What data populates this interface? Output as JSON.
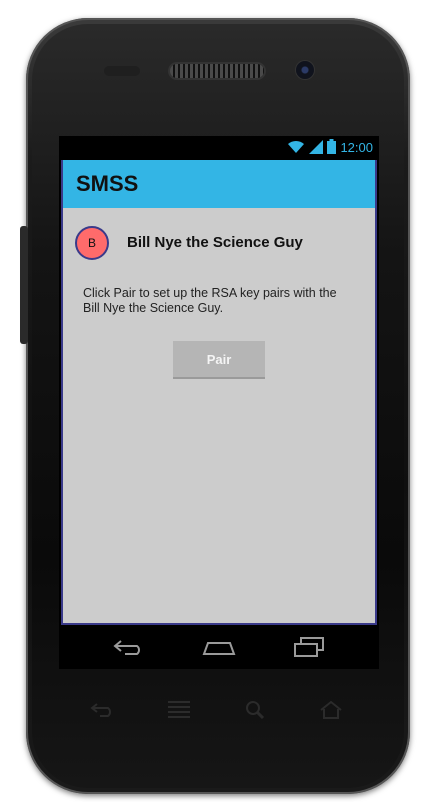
{
  "status_bar": {
    "time": "12:00",
    "icons": [
      "wifi-icon",
      "signal-icon",
      "battery-icon"
    ]
  },
  "app": {
    "title": "SMSS"
  },
  "contact": {
    "avatar_letter": "B",
    "name": "Bill Nye the Science Guy"
  },
  "main": {
    "description": "Click Pair to set up the RSA key pairs with the Bill Nye the Science Guy.",
    "pair_label": "Pair"
  },
  "nav_bar": {
    "icons": [
      "back-icon",
      "home-icon",
      "recent-apps-icon"
    ]
  },
  "hardware_buttons": {
    "icons": [
      "back-icon",
      "menu-icon",
      "search-icon",
      "home-icon"
    ]
  },
  "colors": {
    "action_bar": "#33b5e5",
    "content_bg": "#cccccc",
    "avatar": "#ff6b6b",
    "button": "#b5b5b5"
  }
}
